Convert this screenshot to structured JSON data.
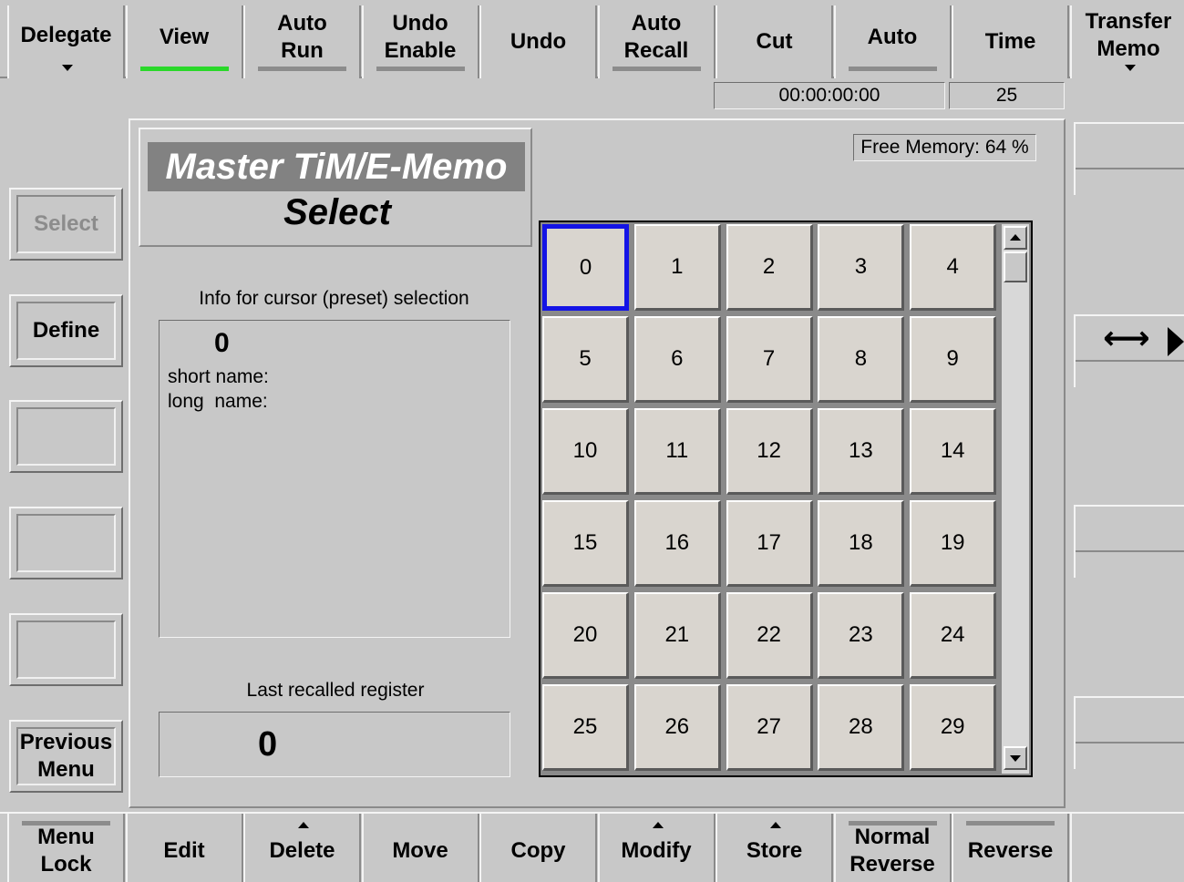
{
  "top_menu": [
    {
      "label": "Delegate",
      "arrow": "down",
      "underline": "none"
    },
    {
      "label": "View",
      "arrow": "none",
      "underline": "green"
    },
    {
      "label": "Auto\nRun",
      "arrow": "none",
      "underline": "gray"
    },
    {
      "label": "Undo\nEnable",
      "arrow": "none",
      "underline": "gray"
    },
    {
      "label": "Undo",
      "arrow": "none",
      "underline": "none"
    },
    {
      "label": "Auto\nRecall",
      "arrow": "none",
      "underline": "gray"
    },
    {
      "label": "Cut",
      "arrow": "none",
      "underline": "none"
    },
    {
      "label": "Auto",
      "arrow": "none",
      "underline": "gray"
    },
    {
      "label": "Time",
      "arrow": "none",
      "underline": "none"
    },
    {
      "label": "Transfer\nMemo",
      "arrow": "down",
      "underline": "none"
    }
  ],
  "status": {
    "timecode": "00:00:00:00",
    "frames": "25"
  },
  "title": {
    "line1": "Master TiM/E-Memo",
    "line2": "Select"
  },
  "free_memory": "Free Memory: 64 %",
  "info": {
    "heading": "Info for cursor (preset) selection",
    "register": "0",
    "short_name": "short name:",
    "long_name": "long  name:"
  },
  "last_recalled": {
    "heading": "Last recalled register",
    "value": "0"
  },
  "left_menu": [
    {
      "label": "Select",
      "disabled": true
    },
    {
      "label": "Define",
      "disabled": false
    },
    {
      "label": "",
      "disabled": false
    },
    {
      "label": "",
      "disabled": false
    },
    {
      "label": "",
      "disabled": false
    },
    {
      "label": "Previous\nMenu",
      "disabled": false
    }
  ],
  "register_grid": {
    "selected": "0",
    "cells": [
      "0",
      "1",
      "2",
      "3",
      "4",
      "5",
      "6",
      "7",
      "8",
      "9",
      "10",
      "11",
      "12",
      "13",
      "14",
      "15",
      "16",
      "17",
      "18",
      "19",
      "20",
      "21",
      "22",
      "23",
      "24",
      "25",
      "26",
      "27",
      "28",
      "29"
    ]
  },
  "right_menu": {
    "arrow_symbol": "⟷"
  },
  "bottom_menu": [
    {
      "label": "Menu\nLock",
      "arrow": "none",
      "topline": true
    },
    {
      "label": "Edit",
      "arrow": "none",
      "topline": false
    },
    {
      "label": "Delete",
      "arrow": "up",
      "topline": false
    },
    {
      "label": "Move",
      "arrow": "none",
      "topline": false
    },
    {
      "label": "Copy",
      "arrow": "none",
      "topline": false
    },
    {
      "label": "Modify",
      "arrow": "up",
      "topline": false
    },
    {
      "label": "Store",
      "arrow": "up",
      "topline": false
    },
    {
      "label": "Normal\nReverse",
      "arrow": "none",
      "topline": true
    },
    {
      "label": "Reverse",
      "arrow": "none",
      "topline": true
    },
    {
      "label": "",
      "arrow": "none",
      "topline": false
    }
  ],
  "colors": {
    "background": "#c8c8c8",
    "selected_border": "#1414e6",
    "active_underline": "#2ad82a",
    "title_bg": "#828282"
  }
}
